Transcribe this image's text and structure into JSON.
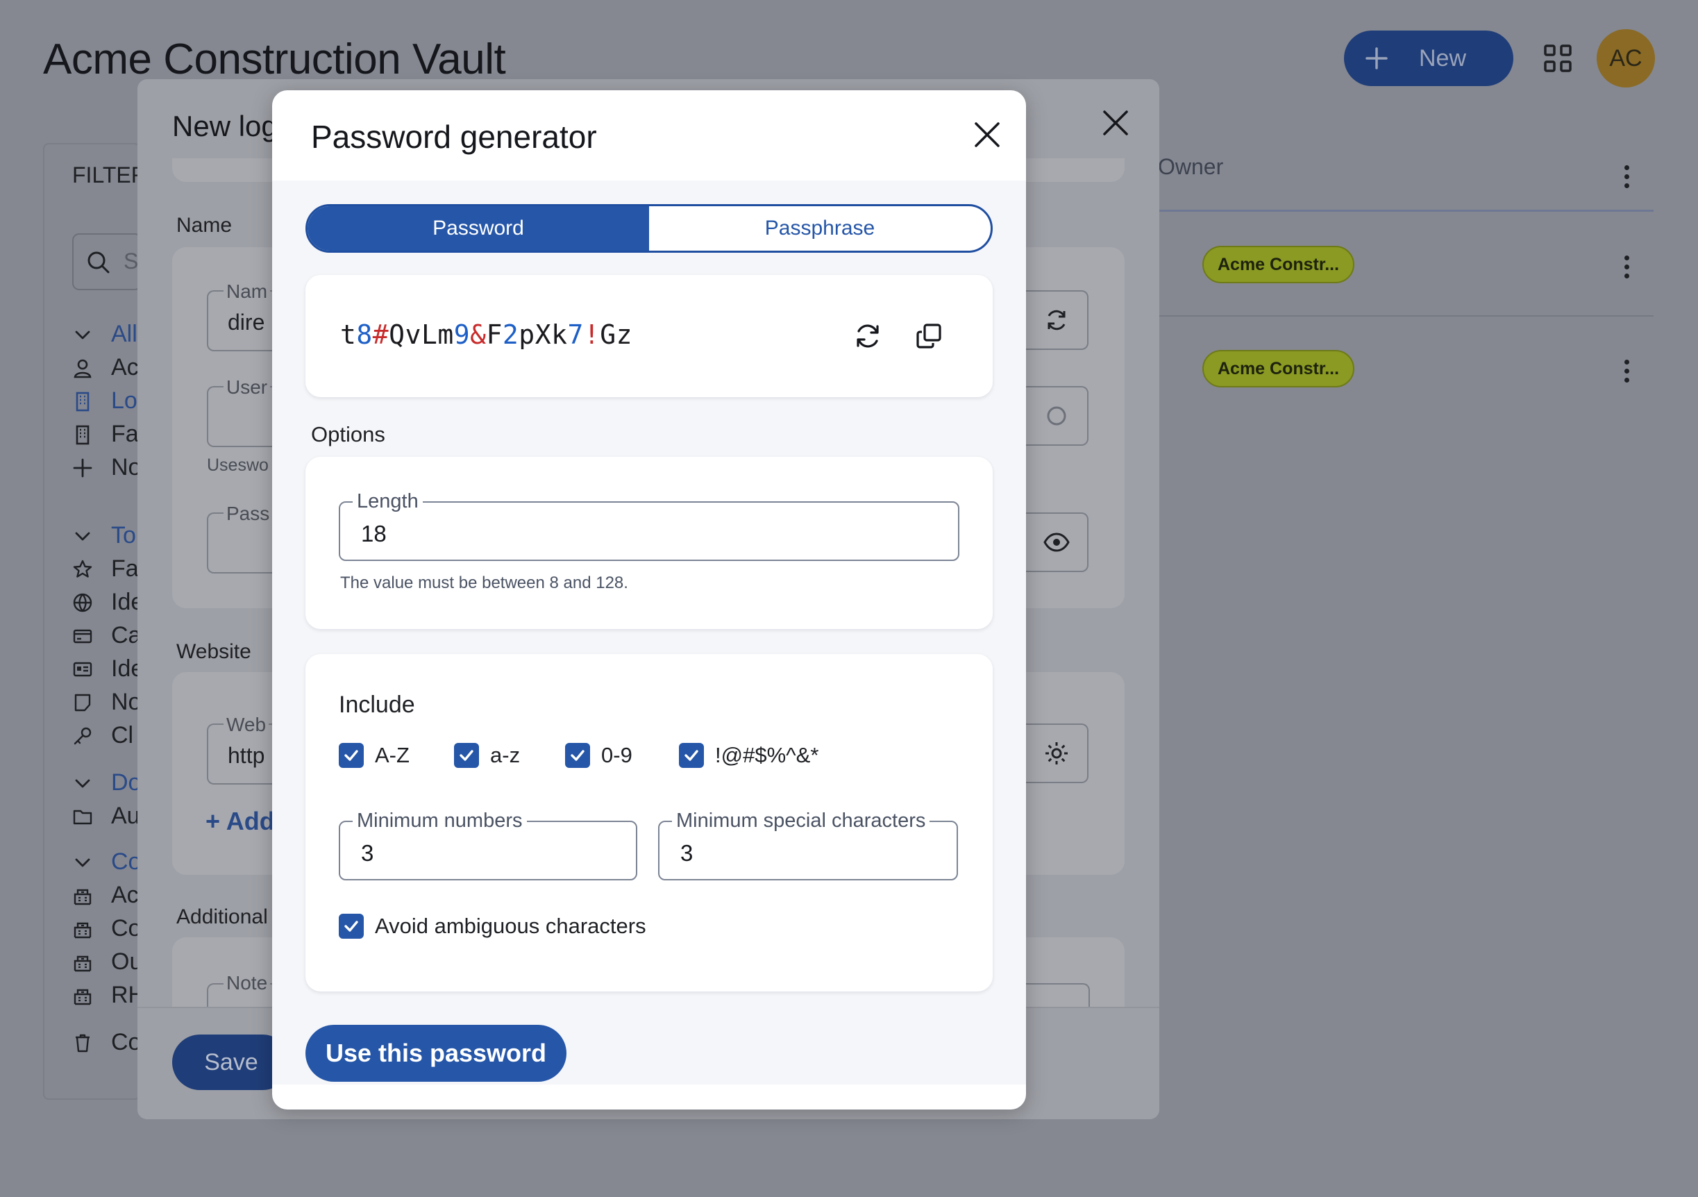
{
  "app": {
    "title": "Acme Construction Vault",
    "new_button": "New",
    "avatar_initials": "AC"
  },
  "filters": {
    "title": "FILTER",
    "search_placeholder": "S",
    "tree": [
      {
        "label": "All",
        "type": "group"
      },
      {
        "label": "Ac",
        "icon": "user-icon"
      },
      {
        "label": "Lo",
        "icon": "building-icon",
        "selected": true
      },
      {
        "label": "Fa",
        "icon": "building-icon"
      },
      {
        "label": "No",
        "icon": "plus-icon"
      },
      {
        "label": "To",
        "type": "group"
      },
      {
        "label": "Fa",
        "icon": "star-icon"
      },
      {
        "label": "Ide",
        "icon": "globe-icon"
      },
      {
        "label": "Ca",
        "icon": "card-icon"
      },
      {
        "label": "Ide",
        "icon": "id-card-icon"
      },
      {
        "label": "No",
        "icon": "note-icon"
      },
      {
        "label": "Cl",
        "icon": "key-icon"
      },
      {
        "label": "Do",
        "type": "group"
      },
      {
        "label": "Au",
        "icon": "folder-icon"
      },
      {
        "label": "Co",
        "type": "group"
      },
      {
        "label": "Ac",
        "icon": "org-icon"
      },
      {
        "label": "Co",
        "icon": "org-icon"
      },
      {
        "label": "Ou",
        "icon": "org-icon"
      },
      {
        "label": "RH",
        "icon": "org-icon"
      },
      {
        "label": "Co",
        "icon": "trash-icon"
      }
    ]
  },
  "table": {
    "owner_header": "Owner",
    "rows": [
      {
        "owner": "Acme Constr..."
      },
      {
        "owner": "Acme Constr..."
      }
    ]
  },
  "login_dialog": {
    "title": "New log",
    "name_section": "Name",
    "name_field_label": "Nam",
    "name_field_value": "dire",
    "username_label": "User",
    "username_hint": "Useswo",
    "password_label": "Pass",
    "website_section": "Website",
    "website_label": "Web",
    "website_value": "http",
    "add_link": "Add",
    "additional_section": "Additional",
    "notes_label": "Note",
    "save_button": "Save"
  },
  "generator": {
    "title": "Password generator",
    "tabs": {
      "password": "Password",
      "passphrase": "Passphrase",
      "active": "password"
    },
    "generated_password": "t8#QvLm9&F2pXk7!Gz",
    "options_label": "Options",
    "length": {
      "label": "Length",
      "value": "18",
      "hint": "The value must be between 8 and 128."
    },
    "include": {
      "label": "Include",
      "uppercase": {
        "label": "A-Z",
        "checked": true
      },
      "lowercase": {
        "label": "a-z",
        "checked": true
      },
      "numbers": {
        "label": "0-9",
        "checked": true
      },
      "special": {
        "label": "!@#$%^&*",
        "checked": true
      }
    },
    "min_numbers": {
      "label": "Minimum numbers",
      "value": "3"
    },
    "min_special": {
      "label": "Minimum special characters",
      "value": "3"
    },
    "avoid_ambiguous": {
      "label": "Avoid ambiguous characters",
      "checked": true
    },
    "use_button": "Use this password"
  },
  "colors": {
    "accent": "#2556a8",
    "digit_color": "#1d5fc6",
    "special_color": "#c82b2b",
    "owner_chip": "#8a9a22",
    "overlay": "#858891"
  }
}
